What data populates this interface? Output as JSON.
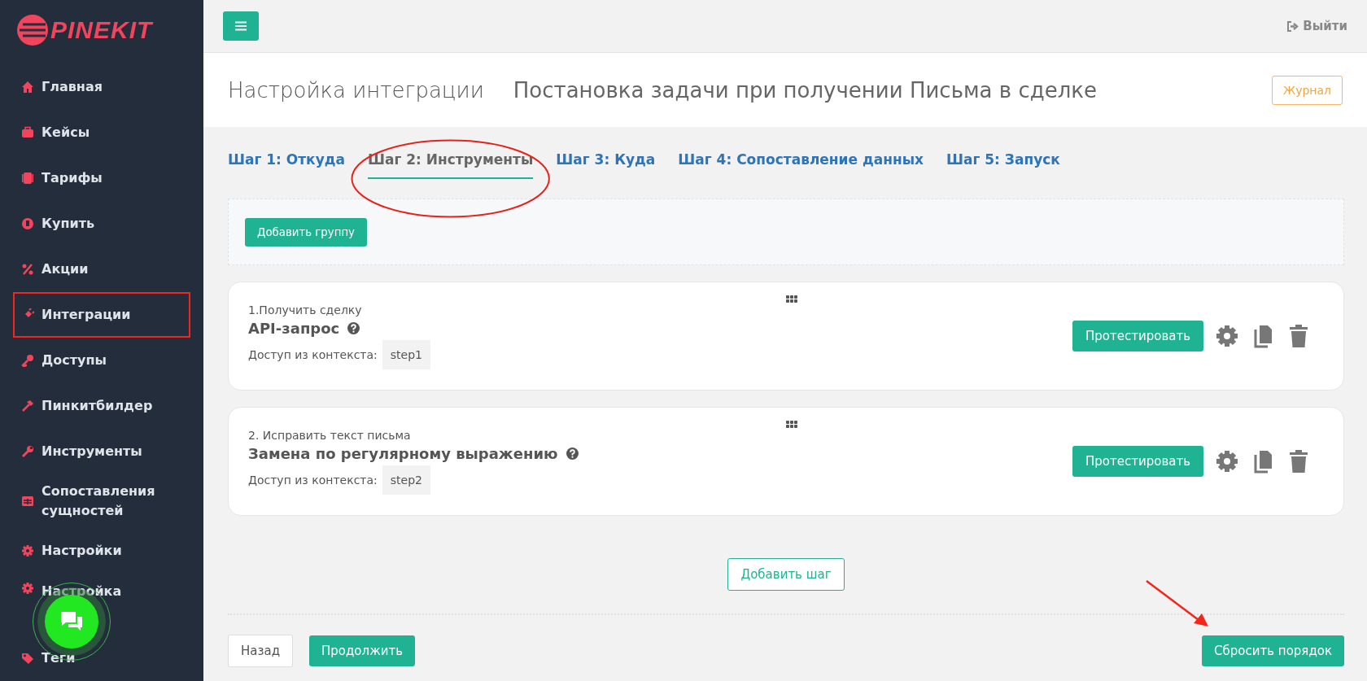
{
  "sidebar": {
    "logo": "PINEKIT",
    "items": [
      {
        "label": "Главная",
        "highlighted": false
      },
      {
        "label": "Кейсы",
        "highlighted": false
      },
      {
        "label": "Тарифы",
        "highlighted": false
      },
      {
        "label": "Купить",
        "highlighted": false
      },
      {
        "label": "Акции",
        "highlighted": false
      },
      {
        "label": "Интеграции",
        "highlighted": true
      },
      {
        "label": "Доступы",
        "highlighted": false
      },
      {
        "label": "Пинкитбилдер",
        "highlighted": false
      },
      {
        "label": "Инструменты",
        "highlighted": false
      },
      {
        "label": "Сопоставления сущностей",
        "highlighted": false
      },
      {
        "label": "Настройки",
        "highlighted": false
      },
      {
        "label": "Настройка",
        "highlighted": false
      },
      {
        "label": "Теги",
        "highlighted": false
      }
    ]
  },
  "topbar": {
    "logout": "Выйти"
  },
  "header": {
    "title": "Настройка интеграции",
    "subtitle": "Постановка задачи при получении Письма в сделке",
    "journal_button": "Журнал"
  },
  "tabs": [
    {
      "label": "Шаг 1: Откуда",
      "selected": false,
      "circled": false
    },
    {
      "label": "Шаг 2: Инструменты",
      "selected": true,
      "circled": true
    },
    {
      "label": "Шаг 3: Куда",
      "selected": false,
      "circled": false
    },
    {
      "label": "Шаг 4: Сопоставление данных",
      "selected": false,
      "circled": false
    },
    {
      "label": "Шаг 5: Запуск",
      "selected": false,
      "circled": false
    }
  ],
  "add_group_button": "Добавить группу",
  "steps": [
    {
      "caption": "1.Получить сделку",
      "title": "API-запрос",
      "context_label": "Доступ из контекста:",
      "context_value": "step1",
      "test_button": "Протестировать"
    },
    {
      "caption": "2. Исправить текст письма",
      "title": "Замена по регулярному выражению",
      "context_label": "Доступ из контекста:",
      "context_value": "step2",
      "test_button": "Протестировать"
    }
  ],
  "add_step_button": "Добавить шаг",
  "footer": {
    "back_button": "Назад",
    "continue_button": "Продолжить",
    "reset_button": "Сбросить порядок"
  }
}
